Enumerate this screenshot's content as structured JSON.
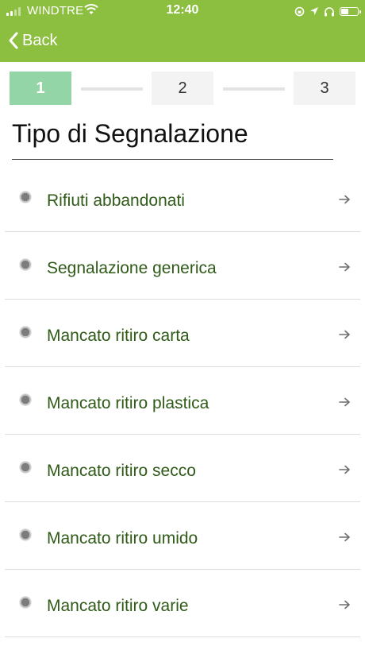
{
  "status_bar": {
    "carrier": "WINDTRE",
    "time": "12:40"
  },
  "nav": {
    "back_label": "Back"
  },
  "stepper": {
    "steps": [
      "1",
      "2",
      "3"
    ],
    "active_step": 1
  },
  "page": {
    "title": "Tipo di Segnalazione"
  },
  "report_types": [
    "Rifiuti abbandonati",
    "Segnalazione generica",
    "Mancato ritiro carta",
    "Mancato ritiro plastica",
    "Mancato ritiro secco",
    "Mancato ritiro umido",
    "Mancato ritiro varie"
  ],
  "colors": {
    "header": "#8cbf3f",
    "active_step": "#94d5a7",
    "item_text": "#2f5a18"
  },
  "icons": {
    "list_item_marker": "radio-icon",
    "list_item_action": "arrow-right-icon"
  }
}
